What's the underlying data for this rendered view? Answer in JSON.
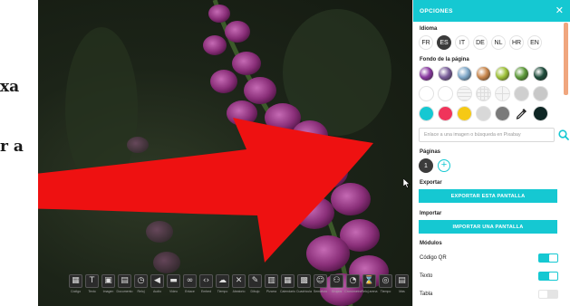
{
  "left_text": {
    "line1": "xa",
    "line2": "r a"
  },
  "toolbar": {
    "tools": [
      {
        "icon": "qr-icon",
        "glyph": "▦",
        "label": "Código"
      },
      {
        "icon": "text-icon",
        "glyph": "T",
        "label": "Texto"
      },
      {
        "icon": "image-icon",
        "glyph": "▣",
        "label": "Imagen"
      },
      {
        "icon": "document-icon",
        "glyph": "▤",
        "label": "Documento"
      },
      {
        "icon": "clock-icon",
        "glyph": "◷",
        "label": "Reloj"
      },
      {
        "icon": "audio-icon",
        "glyph": "◀",
        "label": "Audio"
      },
      {
        "icon": "video-icon",
        "glyph": "▬",
        "label": "Video"
      },
      {
        "icon": "link-icon",
        "glyph": "∞",
        "label": "Enlace"
      },
      {
        "icon": "code-icon",
        "glyph": "‹›",
        "label": "Embed"
      },
      {
        "icon": "weather-icon",
        "glyph": "☁",
        "label": "Tiempo"
      },
      {
        "icon": "random-icon",
        "glyph": "✕",
        "label": "Aleatorio"
      },
      {
        "icon": "draw-icon",
        "glyph": "✎",
        "label": "Dibujo"
      },
      {
        "icon": "board-icon",
        "glyph": "▥",
        "label": "Pizarra"
      },
      {
        "icon": "calendar-icon",
        "glyph": "▦",
        "label": "Calendario"
      },
      {
        "icon": "grid-icon",
        "glyph": "▩",
        "label": "Cuadrícula"
      },
      {
        "icon": "face-icon",
        "glyph": "☺",
        "label": "Semáforo"
      },
      {
        "icon": "group-icon",
        "glyph": "⚇",
        "label": "Grupos"
      },
      {
        "icon": "timer-icon",
        "glyph": "◔",
        "label": "Cronómetro"
      },
      {
        "icon": "hourglass-icon",
        "glyph": "⌛",
        "label": "Reloj arena"
      },
      {
        "icon": "stopwatch-icon",
        "glyph": "◎",
        "label": "Tiempo"
      },
      {
        "icon": "more-icon",
        "glyph": "▤",
        "label": "Más"
      }
    ]
  },
  "panel": {
    "title": "OPCIONES",
    "close": "✕",
    "language": {
      "label": "Idioma",
      "options": [
        "FR",
        "ES",
        "IT",
        "DE",
        "NL",
        "HR",
        "EN"
      ],
      "selected": "ES"
    },
    "background": {
      "label": "Fondo de la página",
      "input_placeholder": "Enlace a una imagen o búsqueda en Pixabay",
      "photo_swatches": [
        "#8a3aa1",
        "#7a5f9a",
        "#7fa8c9",
        "#c9874d",
        "#9fc23a",
        "#5d9a3a",
        "#1f4d3c"
      ],
      "pattern_swatches": [
        "#ffffff",
        "#ffffff",
        "#f4f4f4",
        "#f2f2f2",
        "#f5f5f5",
        "#cfcfcf",
        "#c8c8c8"
      ],
      "color_swatches": [
        "#15c8d2",
        "#f0345b",
        "#f5c915",
        "#d8d8d8",
        "#7a7a7a",
        "#ffffff",
        "#0e2624"
      ]
    },
    "pages": {
      "label": "Páginas",
      "current": "1",
      "add": "+"
    },
    "export": {
      "label": "Exportar",
      "button": "EXPORTAR ESTA PANTALLA"
    },
    "import": {
      "label": "Importar",
      "button": "IMPORTAR UNA PANTALLA"
    },
    "modules": {
      "label": "Módulos",
      "items": [
        {
          "name": "Código QR",
          "on": true
        },
        {
          "name": "Texto",
          "on": true
        },
        {
          "name": "Tabla",
          "on": false
        }
      ]
    }
  },
  "colors": {
    "accent": "#15c8d2",
    "arrow": "#ee1111"
  }
}
